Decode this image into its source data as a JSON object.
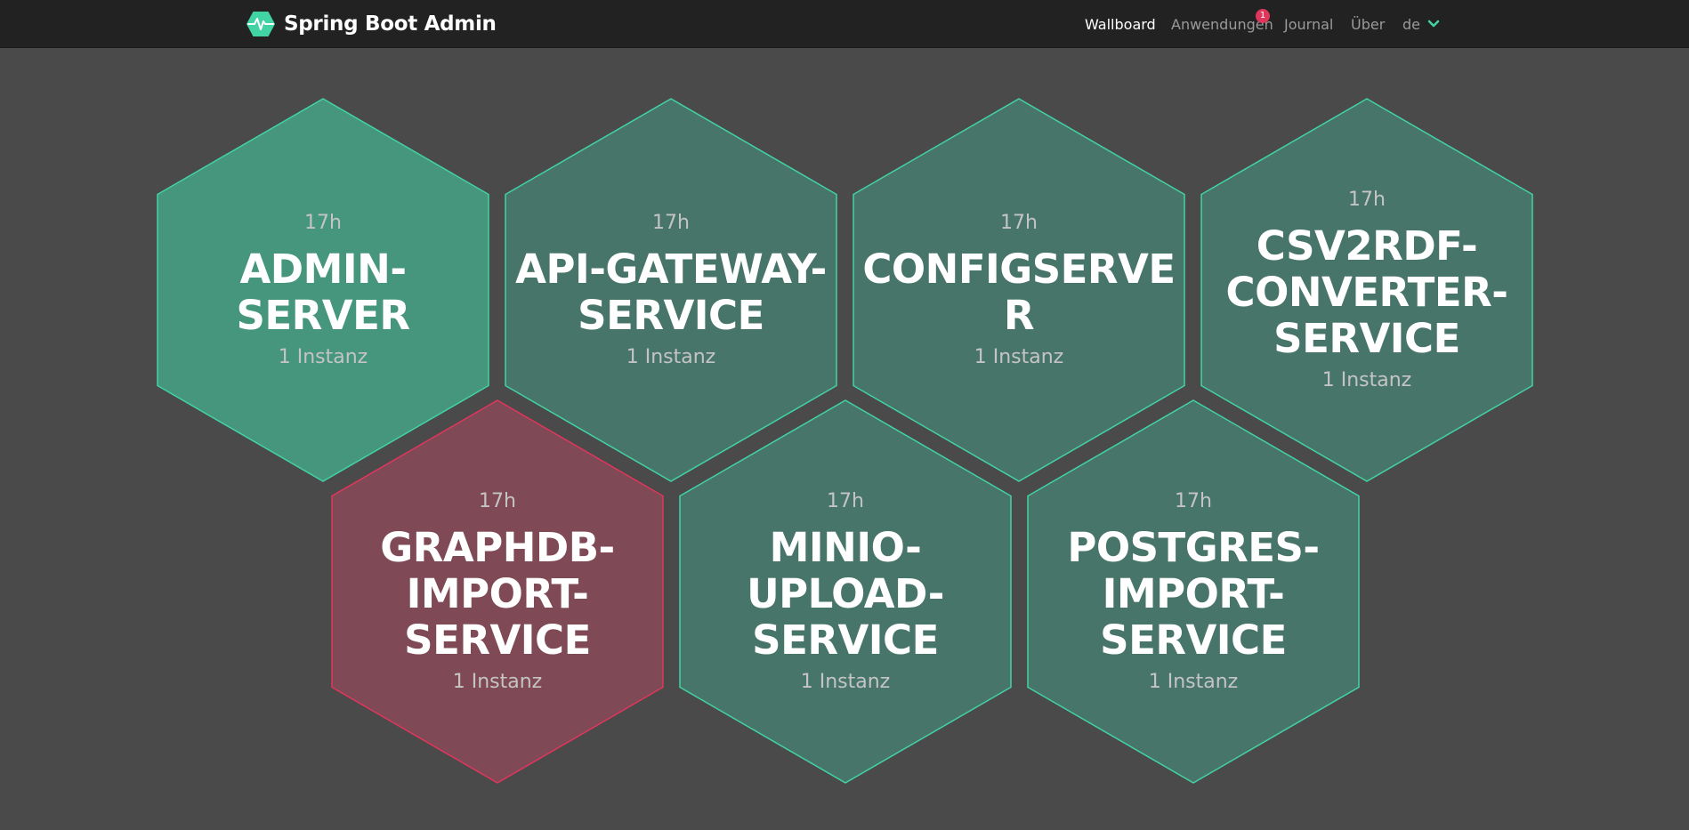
{
  "header": {
    "brand_title": "Spring Boot Admin",
    "brand_icon": "heartbeat-hex-icon",
    "accent_color": "#42d3a5",
    "nav": {
      "wallboard": "Wallboard",
      "applications": "Anwendungen",
      "applications_badge": "1",
      "journal": "Journal",
      "about": "Über",
      "language": "de"
    }
  },
  "colors": {
    "up_fill": "#48756a",
    "up_fill_highlight": "#45967c",
    "up_stroke": "#42d3a5",
    "down_fill": "#7f4a55",
    "down_stroke": "#e0365c",
    "background": "#4a4a4a",
    "topbar": "#222222"
  },
  "applications": [
    {
      "name_line1": "ADMIN-",
      "name_line2": "SERVER",
      "name_line3": "",
      "uptime": "17h",
      "instances": "1 Instanz",
      "status": "UP"
    },
    {
      "name_line1": "API-GATEWAY-",
      "name_line2": "SERVICE",
      "name_line3": "",
      "uptime": "17h",
      "instances": "1 Instanz",
      "status": "UP"
    },
    {
      "name_line1": "CONFIGSERVER",
      "name_line2": "",
      "name_line3": "",
      "uptime": "17h",
      "instances": "1 Instanz",
      "status": "UP"
    },
    {
      "name_line1": "CSV2RDF-",
      "name_line2": "CONVERTER-",
      "name_line3": "SERVICE",
      "uptime": "17h",
      "instances": "1 Instanz",
      "status": "UP"
    },
    {
      "name_line1": "GRAPHDB-",
      "name_line2": "IMPORT-",
      "name_line3": "SERVICE",
      "uptime": "17h",
      "instances": "1 Instanz",
      "status": "DOWN"
    },
    {
      "name_line1": "MINIO-UPLOAD-",
      "name_line2": "SERVICE",
      "name_line3": "",
      "uptime": "17h",
      "instances": "1 Instanz",
      "status": "UP"
    },
    {
      "name_line1": "POSTGRES-",
      "name_line2": "IMPORT-",
      "name_line3": "SERVICE",
      "uptime": "17h",
      "instances": "1 Instanz",
      "status": "UP"
    }
  ]
}
